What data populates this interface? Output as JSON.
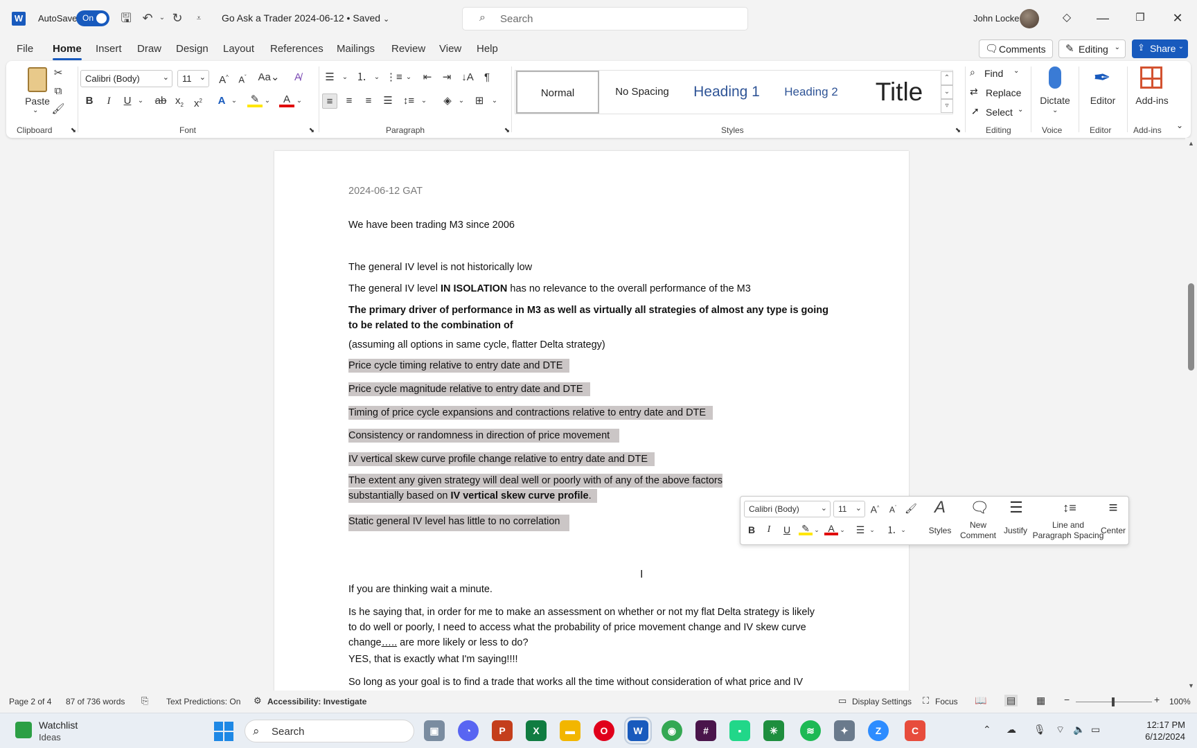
{
  "titlebar": {
    "autosave_label": "AutoSave",
    "autosave_state": "On",
    "doc_title": "Go Ask a Trader 2024-06-12 • Saved",
    "search_placeholder": "Search",
    "user_name": "John Locke"
  },
  "menu": {
    "tabs": [
      "File",
      "Home",
      "Insert",
      "Draw",
      "Design",
      "Layout",
      "References",
      "Mailings",
      "Review",
      "View",
      "Help"
    ],
    "active": "Home",
    "comments_label": "Comments",
    "editing_label": "Editing",
    "share_label": "Share"
  },
  "ribbon": {
    "paste_label": "Paste",
    "font_name": "Calibri (Body)",
    "font_size": "11",
    "styles": [
      "Normal",
      "No Spacing",
      "Heading 1",
      "Heading 2",
      "Title"
    ],
    "find_label": "Find",
    "replace_label": "Replace",
    "select_label": "Select",
    "dictate_label": "Dictate",
    "editor_label": "Editor",
    "addins_label": "Add-ins",
    "groups": {
      "clipboard": "Clipboard",
      "font": "Font",
      "paragraph": "Paragraph",
      "styles": "Styles",
      "editing": "Editing",
      "voice": "Voice",
      "editor": "Editor",
      "addins": "Add-ins"
    }
  },
  "document": {
    "header": "2024-06-12 GAT",
    "p1": "We have been trading M3 since 2006",
    "p2": "The general IV level is not historically low",
    "p3_a": "The general IV level ",
    "p3_b": "IN ISOLATION",
    "p3_c": " has no relevance to the overall performance of the M3",
    "p4_line1": "The primary driver of performance in M3 as well as virtually all strategies of almost any type is going",
    "p4_line2": "to be related to the combination of",
    "p5": "(assuming all options in same cycle, flatter Delta strategy)",
    "list": [
      "Price cycle timing relative to entry date and DTE",
      "Price cycle magnitude relative to entry date and DTE",
      "Timing of price cycle expansions and contractions relative to entry date and DTE",
      "Consistency or randomness in direction of price movement",
      "IV vertical skew curve profile change relative to entry date and DTE"
    ],
    "p6_line1": "The extent any given strategy will deal well or poorly with of any of the above factors",
    "p6_line2_a": "substantially based on ",
    "p6_line2_b": "IV vertical skew curve profile",
    "p6_line2_c": ".",
    "p7": "Static general IV level has little to no correlation",
    "p8": "If you are thinking wait a minute.",
    "p9_line1": "Is he saying that, in order for me to make an assessment on whether or not my flat Delta strategy is likely",
    "p9_line2": "to do well or poorly, I need to access what the probability of price movement change and IV skew curve",
    "p9_line3_a": "change",
    "p9_line3_b": "…..",
    "p9_line3_c": " are more likely or less to do?",
    "p10": "YES, that is exactly what I'm saying!!!!",
    "p11": "So long as your goal is to find a trade that works all the time without consideration of what price and IV"
  },
  "minibar": {
    "font_name": "Calibri (Body)",
    "font_size": "11",
    "styles_label": "Styles",
    "new_comment_label_1": "New",
    "new_comment_label_2": "Comment",
    "justify_label": "Justify",
    "line_spacing_label_1": "Line and",
    "line_spacing_label_2": "Paragraph Spacing",
    "center_label": "Center"
  },
  "status": {
    "page": "Page 2 of 4",
    "words": "87 of 736 words",
    "text_predictions": "Text Predictions: On",
    "accessibility": "Accessibility: Investigate",
    "display_settings": "Display Settings",
    "focus": "Focus",
    "zoom": "100%"
  },
  "taskbar": {
    "widget_title": "Watchlist",
    "widget_sub": "Ideas",
    "search_placeholder": "Search",
    "time": "12:17 PM",
    "date": "6/12/2024"
  },
  "colors": {
    "accent": "#185abd",
    "selection": "#cbc6c6"
  }
}
